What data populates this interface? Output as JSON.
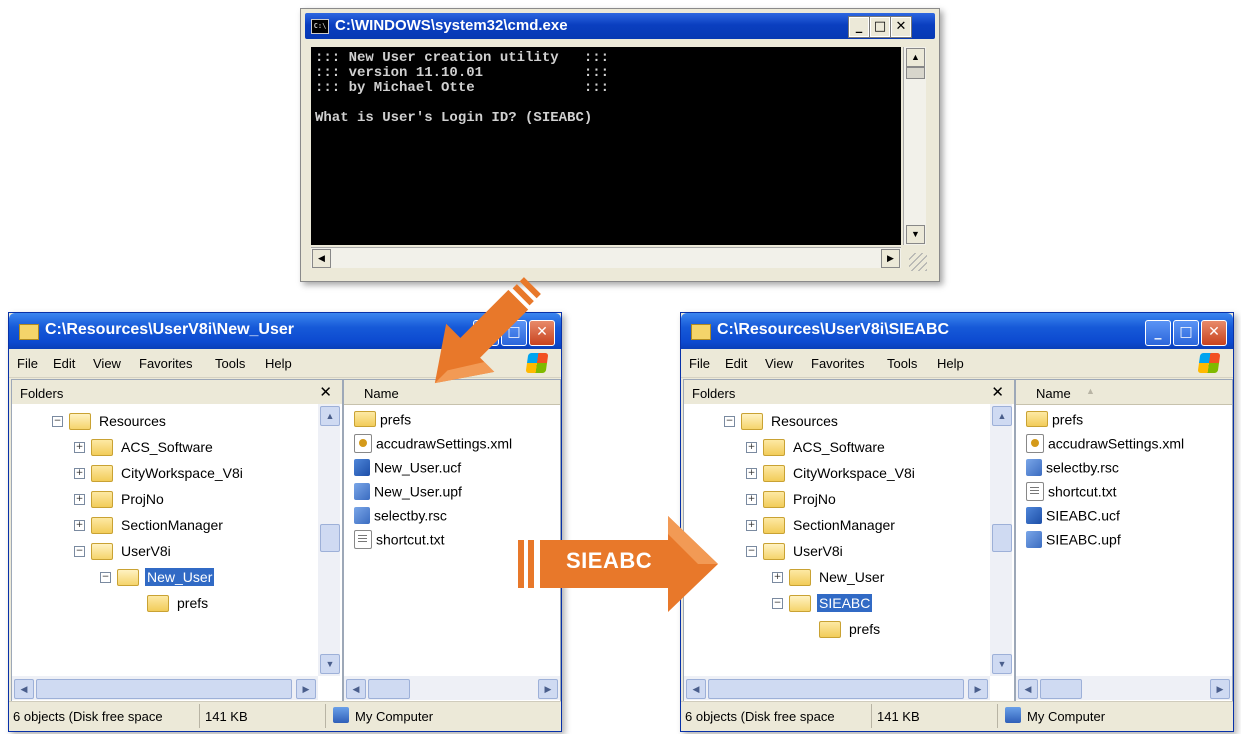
{
  "cmd": {
    "title": "C:\\WINDOWS\\system32\\cmd.exe",
    "icon_text": "C:\\",
    "console_lines": [
      "::: New User creation utility   :::",
      "::: version 11.10.01            :::",
      "::: by Michael Otte             :::",
      "",
      "What is User's Login ID? (SIEABC)"
    ],
    "buttons": {
      "minimize": "_",
      "maximize": "□",
      "close": "✕"
    }
  },
  "arrow_label": "SIEABC",
  "explorer_left": {
    "title": "C:\\Resources\\UserV8i\\New_User",
    "menu": [
      "File",
      "Edit",
      "View",
      "Favorites",
      "Tools",
      "Help"
    ],
    "folders_label": "Folders",
    "folders_close": "✕",
    "tree": [
      {
        "label": "Resources",
        "toggle": "−",
        "open": true
      },
      {
        "label": "ACS_Software",
        "toggle": "+"
      },
      {
        "label": "CityWorkspace_V8i",
        "toggle": "+"
      },
      {
        "label": "ProjNo",
        "toggle": "+"
      },
      {
        "label": "SectionManager",
        "toggle": "+"
      },
      {
        "label": "UserV8i",
        "toggle": "−",
        "open": true
      },
      {
        "label": "New_User",
        "toggle": "−",
        "open": true,
        "selected": true
      },
      {
        "label": "prefs",
        "toggle": ""
      }
    ],
    "name_header": "Name",
    "files": [
      {
        "name": "prefs",
        "icon": "folder"
      },
      {
        "name": "accudrawSettings.xml",
        "icon": "xml"
      },
      {
        "name": "New_User.ucf",
        "icon": "ms"
      },
      {
        "name": "New_User.upf",
        "icon": "ms2"
      },
      {
        "name": "selectby.rsc",
        "icon": "ms2"
      },
      {
        "name": "shortcut.txt",
        "icon": "txt"
      }
    ],
    "status": {
      "objects": "6 objects (Disk free space",
      "size": "141 KB",
      "location": "My Computer"
    }
  },
  "explorer_right": {
    "title": "C:\\Resources\\UserV8i\\SIEABC",
    "menu": [
      "File",
      "Edit",
      "View",
      "Favorites",
      "Tools",
      "Help"
    ],
    "folders_label": "Folders",
    "folders_close": "✕",
    "tree": [
      {
        "label": "Resources",
        "toggle": "−",
        "open": true
      },
      {
        "label": "ACS_Software",
        "toggle": "+"
      },
      {
        "label": "CityWorkspace_V8i",
        "toggle": "+"
      },
      {
        "label": "ProjNo",
        "toggle": "+"
      },
      {
        "label": "SectionManager",
        "toggle": "+"
      },
      {
        "label": "UserV8i",
        "toggle": "−",
        "open": true
      },
      {
        "label": "New_User",
        "toggle": "+"
      },
      {
        "label": "SIEABC",
        "toggle": "−",
        "open": true,
        "selected": true
      },
      {
        "label": "prefs",
        "toggle": ""
      }
    ],
    "name_header": "Name",
    "name_sort_glyph": "▲",
    "files": [
      {
        "name": "prefs",
        "icon": "folder"
      },
      {
        "name": "accudrawSettings.xml",
        "icon": "xml"
      },
      {
        "name": "selectby.rsc",
        "icon": "ms2"
      },
      {
        "name": "shortcut.txt",
        "icon": "txt"
      },
      {
        "name": "SIEABC.ucf",
        "icon": "ms"
      },
      {
        "name": "SIEABC.upf",
        "icon": "ms2"
      }
    ],
    "status": {
      "objects": "6 objects (Disk free space",
      "size": "141 KB",
      "location": "My Computer"
    }
  },
  "colors": {
    "arrow": "#e8782a",
    "arrow_dark": "#c45a12",
    "selection": "#316ac5",
    "titlebar": "#0c4ad0"
  }
}
